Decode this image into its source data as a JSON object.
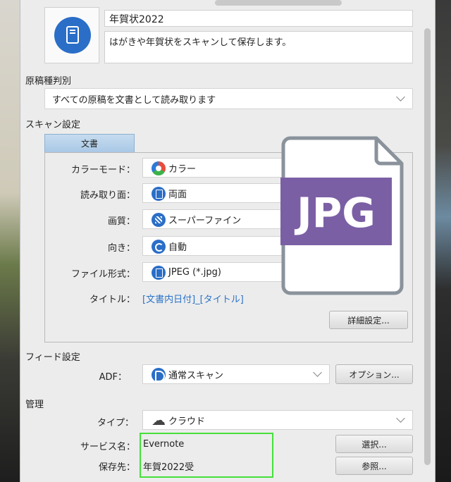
{
  "profile": {
    "name": "年賀状2022",
    "description": "はがきや年賀状をスキャンして保存します。",
    "icon": "document-icon"
  },
  "document_type": {
    "label": "原稿種判別",
    "value": "すべての原稿を文書として読み取ります"
  },
  "scan_settings": {
    "label": "スキャン設定",
    "tab": "文書",
    "rows": [
      {
        "label": "カラーモード：",
        "value": "カラー",
        "icon": "color-icon"
      },
      {
        "label": "読み取り面：",
        "value": "両面",
        "icon": "duplex-icon"
      },
      {
        "label": "画質：",
        "value": "スーパーファイン",
        "icon": "quality-icon"
      },
      {
        "label": "向き：",
        "value": "自動",
        "icon": "rotate-icon"
      },
      {
        "label": "ファイル形式：",
        "value": "JPEG (*.jpg)",
        "icon": "file-format-icon"
      }
    ],
    "title_label": "タイトル：",
    "title_value": "[文書内日付]_[タイトル]",
    "detail_button": "詳細設定..."
  },
  "jpg_overlay": {
    "text": "JPG",
    "color": "#7b5fa5"
  },
  "feed": {
    "label": "フィード設定",
    "adf_label": "ADF：",
    "adf_value": "通常スキャン",
    "options_button": "オプション..."
  },
  "manage": {
    "label": "管理",
    "type_label": "タイプ：",
    "type_value": "クラウド",
    "service_label": "サービス名：",
    "service_value": "Evernote",
    "save_label": "保存先：",
    "save_value": "年賀2022受",
    "select_button": "選択...",
    "browse_button": "参照..."
  },
  "colors": {
    "accent": "#2a6ec7",
    "highlight": "#44e03a"
  }
}
